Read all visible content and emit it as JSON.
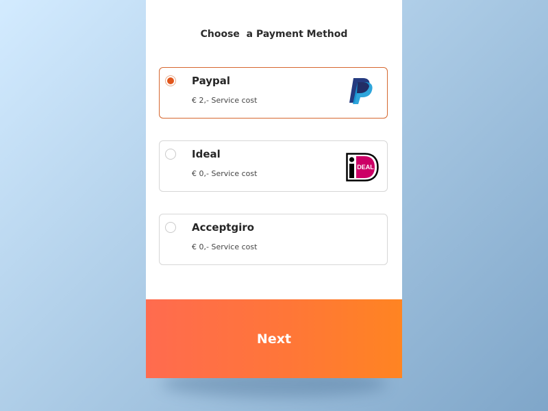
{
  "header": {
    "title": "Choose  a Payment Method"
  },
  "options": [
    {
      "name": "Paypal",
      "cost": "€ 2,- Service cost",
      "selected": true,
      "icon": "paypal-logo"
    },
    {
      "name": "Ideal",
      "cost": "€ 0,- Service cost",
      "selected": false,
      "icon": "ideal-logo"
    },
    {
      "name": "Acceptgiro",
      "cost": "€ 0,- Service cost",
      "selected": false,
      "icon": ""
    }
  ],
  "ideal_logo_text": "DEAL",
  "footer": {
    "next_label": "Next"
  },
  "colors": {
    "accent": "#e1561c",
    "selected_border": "#d5662d",
    "button_gradient_start": "#ff6b4f",
    "button_gradient_end": "#ff8422",
    "paypal_dark": "#253b80",
    "paypal_light": "#179bd7",
    "ideal_pink": "#cc0066"
  }
}
